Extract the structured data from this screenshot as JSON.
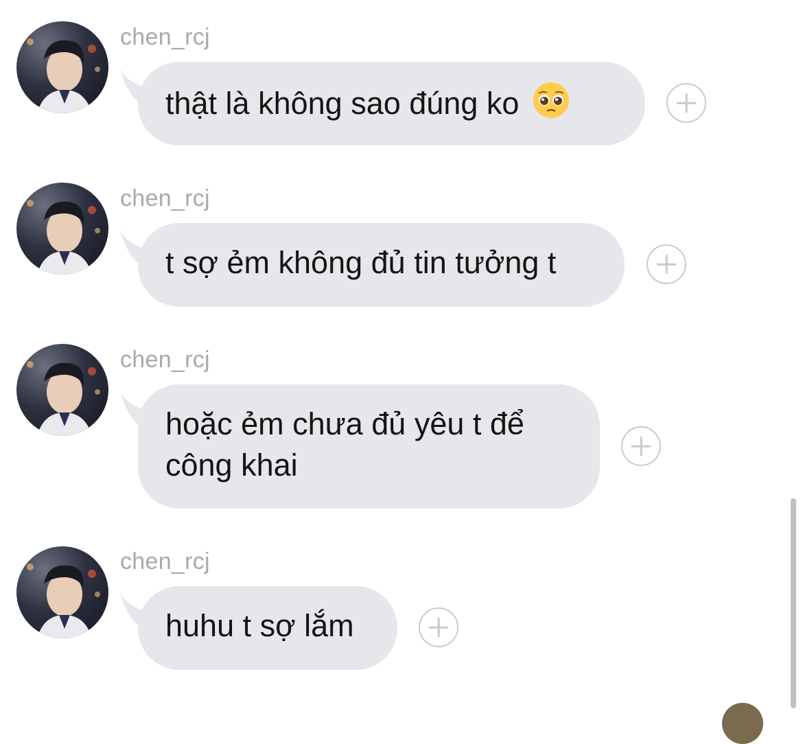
{
  "messages": [
    {
      "sender": "chen_rcj",
      "text": "thật là không sao đúng ko",
      "emoji": "pleading-face-icon"
    },
    {
      "sender": "chen_rcj",
      "text": "t sợ ẻm không đủ tin tưởng t"
    },
    {
      "sender": "chen_rcj",
      "text_line1": "hoặc ẻm chưa đủ yêu t để",
      "text_line2": "công khai"
    },
    {
      "sender": "chen_rcj",
      "text": "huhu t sợ lắm"
    }
  ],
  "colors": {
    "bubble": "#e5e7ea",
    "sender_text": "#a7a9ae",
    "message_text": "#141414",
    "react_icon": "#c8cacd"
  }
}
